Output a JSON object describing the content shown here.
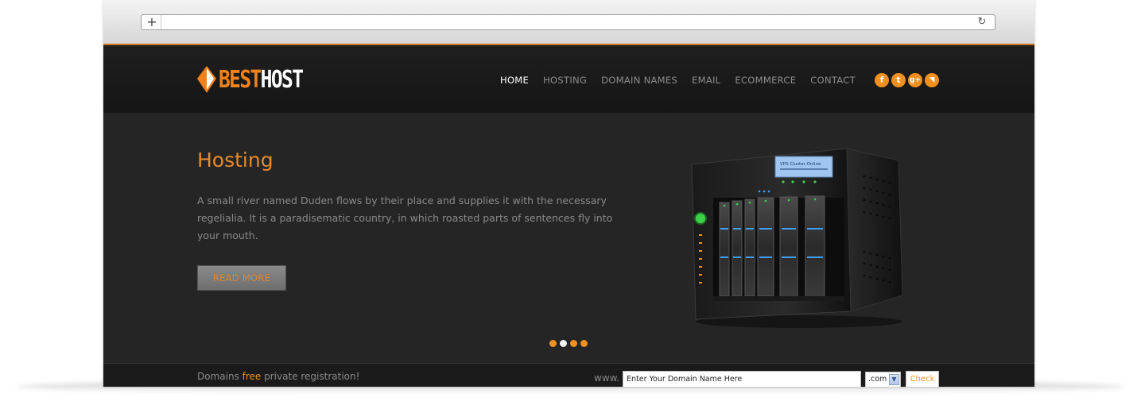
{
  "browser": {
    "new_tab_icon": "plus-icon",
    "reload_icon": "reload-icon"
  },
  "site": {
    "logo_best": "BEST",
    "logo_host": "HOST",
    "nav": [
      {
        "label": "HOME",
        "active": true
      },
      {
        "label": "HOSTING",
        "active": false
      },
      {
        "label": "DOMAIN NAMES",
        "active": false
      },
      {
        "label": "EMAIL",
        "active": false
      },
      {
        "label": "ECOMMERCE",
        "active": false
      },
      {
        "label": "CONTACT",
        "active": false
      }
    ],
    "social": [
      {
        "icon": "facebook-icon",
        "glyph": "f"
      },
      {
        "icon": "twitter-icon",
        "glyph": "t"
      },
      {
        "icon": "google-plus-icon",
        "glyph": "g+"
      },
      {
        "icon": "rss-icon",
        "glyph": "◥"
      }
    ]
  },
  "hero": {
    "title": "Hosting",
    "text": "A small river named Duden flows by their place and supplies it with the necessary regelialia. It is a paradisematic country, in which roasted parts of sentences fly into your mouth.",
    "button": "READ MORE",
    "server_screen_title": "VPS Cluster Online",
    "slider_count": 4,
    "slider_active_index": 1
  },
  "domain_bar": {
    "text_before": "Domains ",
    "text_free": "free",
    "text_after": " private registration!",
    "www": "www.",
    "input_value": "Enter Your Domain Name Here",
    "tld_value": ".com",
    "check_label": "Check"
  },
  "colors": {
    "accent": "#f0901e",
    "background": "#252525",
    "header": "#1a1a1a"
  }
}
